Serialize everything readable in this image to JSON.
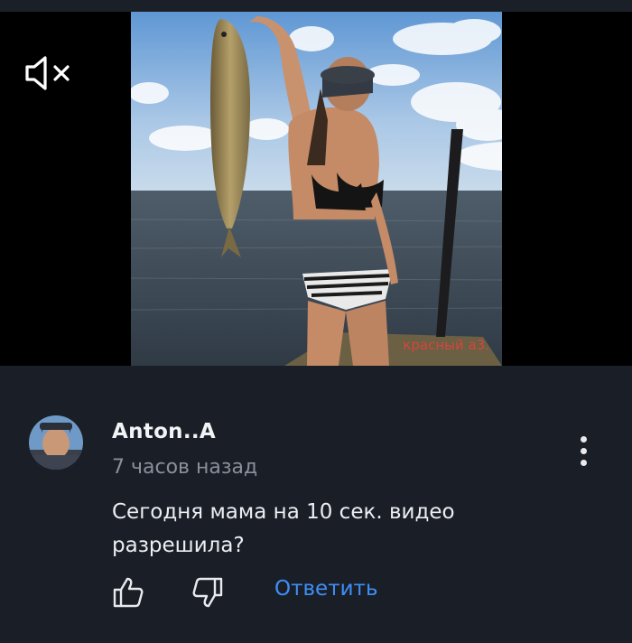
{
  "video": {
    "watermark": "красный а3.",
    "mute_icon": "muted-speaker-icon"
  },
  "comment": {
    "author": "Anton..A",
    "timestamp": "7 часов назад",
    "text": "Сегодня мама на 10 сек. видео разрешила?",
    "reply_label": "Ответить",
    "reply_color": "#3e8ff5",
    "icons": [
      "more-vertical-icon",
      "thumbs-up-icon",
      "thumbs-down-icon"
    ]
  }
}
